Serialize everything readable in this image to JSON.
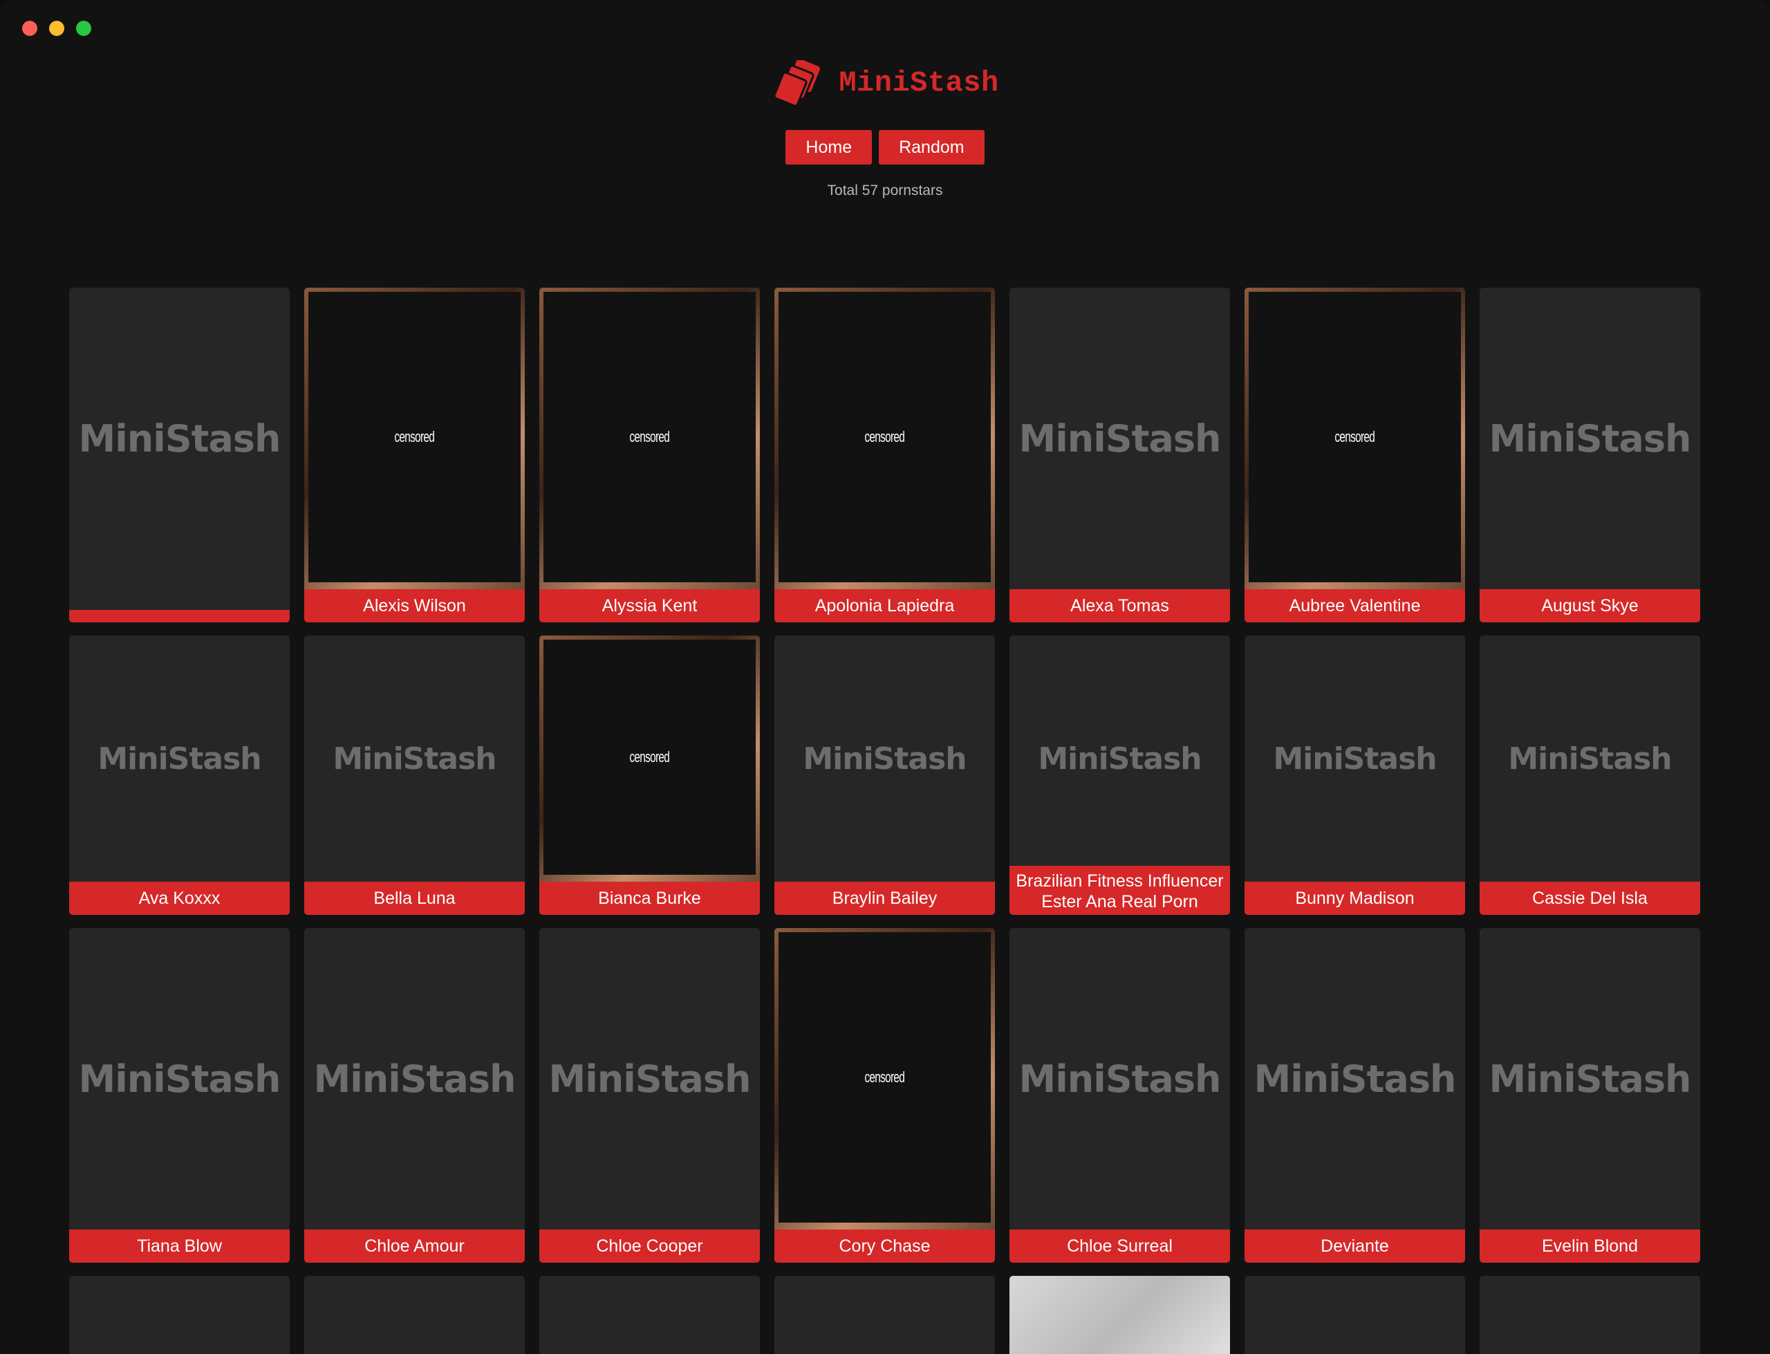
{
  "app": {
    "name": "MiniStash",
    "brand_color": "#d62828"
  },
  "nav": {
    "home_label": "Home",
    "random_label": "Random"
  },
  "summary": {
    "total_text": "Total 57 pornstars"
  },
  "placeholder_text": "MiniStash",
  "censor_text": "censored",
  "cards": [
    {
      "name": "",
      "image": false
    },
    {
      "name": "Alexis Wilson",
      "image": true
    },
    {
      "name": "Alyssia Kent",
      "image": true
    },
    {
      "name": "Apolonia Lapiedra",
      "image": true
    },
    {
      "name": "Alexa Tomas",
      "image": false
    },
    {
      "name": "Aubree Valentine",
      "image": true
    },
    {
      "name": "August Skye",
      "image": false
    },
    {
      "name": "Ava Koxxx",
      "image": false
    },
    {
      "name": "Bella Luna",
      "image": false
    },
    {
      "name": "Bianca Burke",
      "image": true
    },
    {
      "name": "Braylin Bailey",
      "image": false
    },
    {
      "name": "Brazilian Fitness Influencer Ester Ana Real Porn",
      "image": false
    },
    {
      "name": "Bunny Madison",
      "image": false
    },
    {
      "name": "Cassie Del Isla",
      "image": false
    },
    {
      "name": "Tiana Blow",
      "image": false
    },
    {
      "name": "Chloe Amour",
      "image": false
    },
    {
      "name": "Chloe Cooper",
      "image": false
    },
    {
      "name": "Cory Chase",
      "image": true
    },
    {
      "name": "Chloe Surreal",
      "image": false
    },
    {
      "name": "Deviante",
      "image": false
    },
    {
      "name": "Evelin Blond",
      "image": false
    },
    {
      "name": "",
      "image": false
    },
    {
      "name": "",
      "image": false
    },
    {
      "name": "",
      "image": false
    },
    {
      "name": "",
      "image": false
    },
    {
      "name": "",
      "image": true
    },
    {
      "name": "",
      "image": false
    },
    {
      "name": "",
      "image": false
    }
  ]
}
